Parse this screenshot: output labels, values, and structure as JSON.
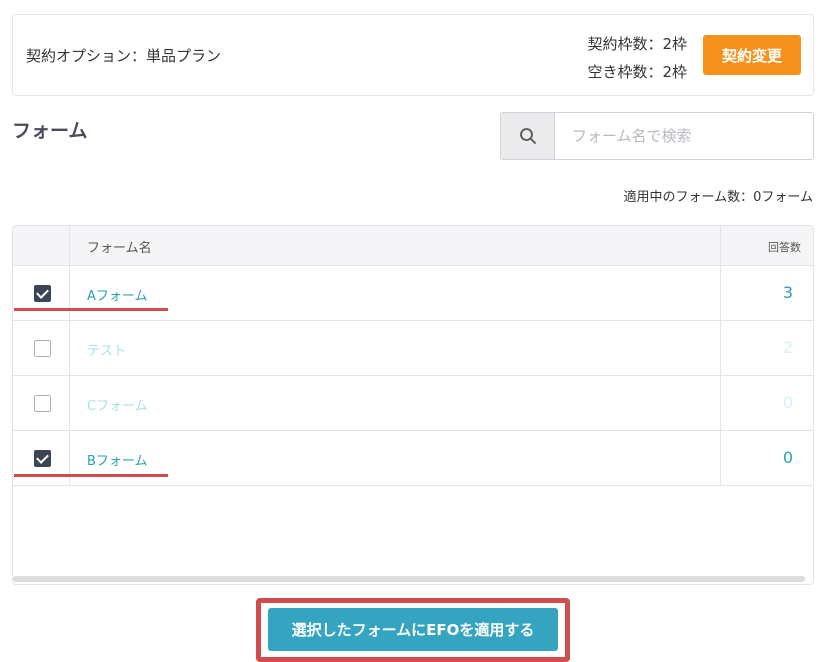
{
  "contract": {
    "option_label": "契約オプション：単品プラン",
    "slots_total": "契約枠数：2枠",
    "slots_free": "空き枠数：2枠",
    "change_button": "契約変更"
  },
  "section": {
    "title": "フォーム"
  },
  "search": {
    "placeholder": "フォーム名で検索",
    "value": ""
  },
  "applied_count": "適用中のフォーム数：0フォーム",
  "table": {
    "headers": {
      "name": "フォーム名",
      "responses": "回答数"
    },
    "rows": [
      {
        "name": "Aフォーム",
        "responses": "3",
        "checked": true,
        "enabled": true
      },
      {
        "name": "テスト",
        "responses": "2",
        "checked": false,
        "enabled": false
      },
      {
        "name": "Cフォーム",
        "responses": "0",
        "checked": false,
        "enabled": false
      },
      {
        "name": "Bフォーム",
        "responses": "0",
        "checked": true,
        "enabled": true
      }
    ]
  },
  "apply_button": "選択したフォームにEFOを適用する",
  "colors": {
    "accent_orange": "#f5921e",
    "primary_blue": "#35a4c0",
    "link_blue": "#2a9fb5",
    "highlight_red": "#d14c4c",
    "checkbox_dark": "#3b4556"
  }
}
